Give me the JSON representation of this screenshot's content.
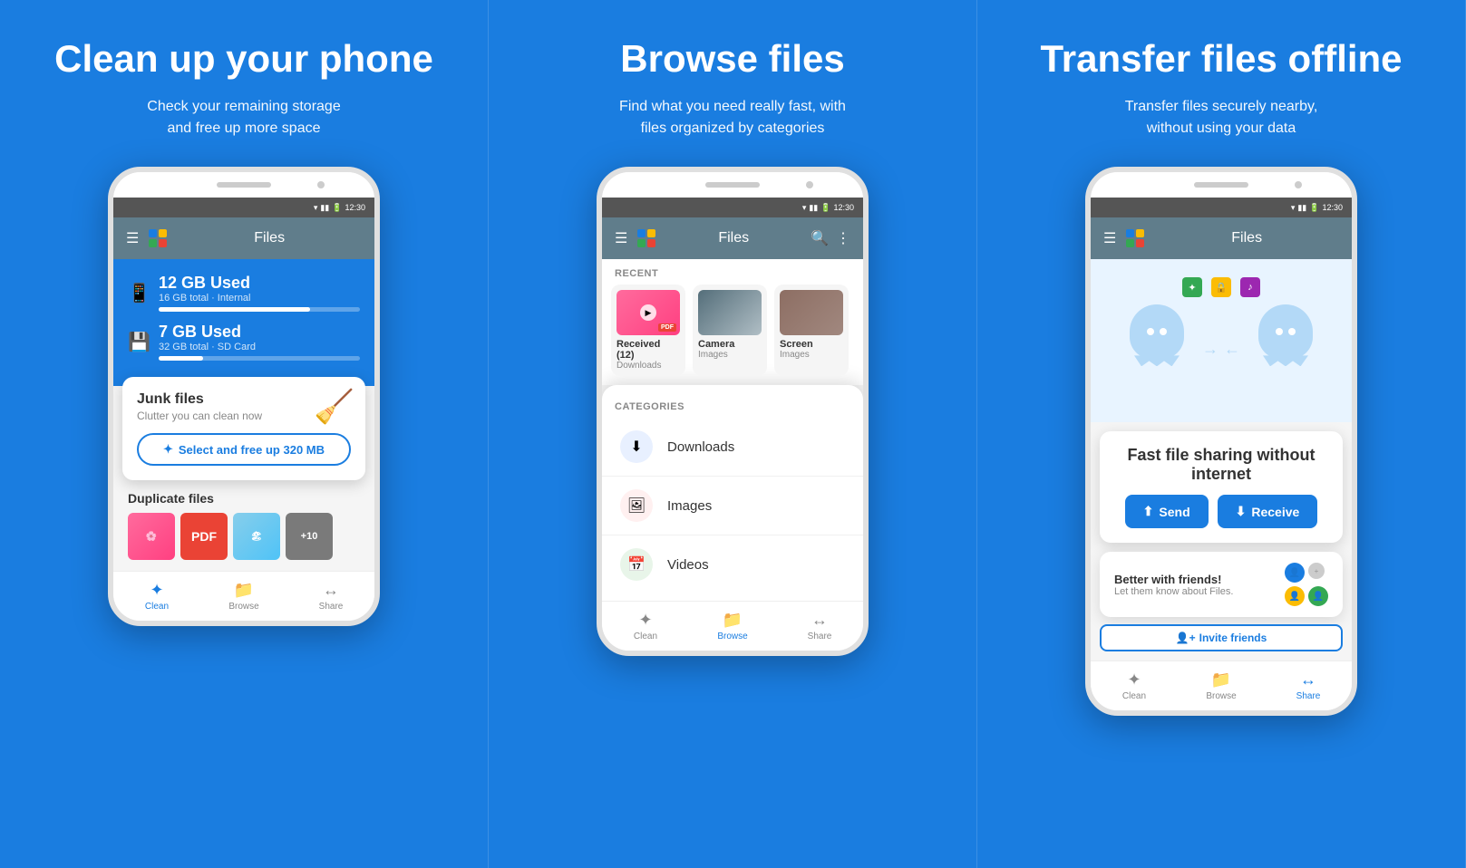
{
  "panel1": {
    "title": "Clean up your phone",
    "subtitle": "Check your remaining storage\nand free up more space",
    "storage": [
      {
        "label": "12 GB Used",
        "sub": "16 GB total · Internal",
        "fill": 75,
        "icon": "📱"
      },
      {
        "label": "7 GB Used",
        "sub": "32 GB total · SD Card",
        "fill": 22,
        "icon": "💾"
      }
    ],
    "junk_card": {
      "title": "Junk files",
      "sub": "Clutter you can clean now",
      "btn": "Select and free up 320 MB"
    },
    "duplicate": {
      "title": "Duplicate files"
    },
    "nav": [
      "Clean",
      "Browse",
      "Share"
    ]
  },
  "panel2": {
    "title": "Browse files",
    "subtitle": "Find what you need really fast, with\nfiles organized by categories",
    "recent_label": "RECENT",
    "recent_items": [
      {
        "label": "Received (12)",
        "sub": "Downloads"
      },
      {
        "label": "Camera",
        "sub": "Images"
      },
      {
        "label": "Screen",
        "sub": "Images"
      }
    ],
    "categories_label": "CATEGORIES",
    "categories": [
      {
        "name": "Downloads",
        "icon": "⬇"
      },
      {
        "name": "Images",
        "icon": "🖼"
      },
      {
        "name": "Videos",
        "icon": "📅"
      }
    ],
    "nav": [
      "Clean",
      "Browse",
      "Share"
    ]
  },
  "panel3": {
    "title": "Transfer files offline",
    "subtitle": "Transfer files securely nearby,\nwithout using your data",
    "sharing_card": {
      "title": "Fast file sharing without internet",
      "send_btn": "Send",
      "receive_btn": "Receive"
    },
    "friends_card": {
      "title": "Better with friends!",
      "sub": "Let them know about Files.",
      "invite_btn": "Invite friends"
    },
    "nav": [
      "Clean",
      "Browse",
      "Share"
    ]
  },
  "app": {
    "name": "Files",
    "time": "12:30"
  }
}
